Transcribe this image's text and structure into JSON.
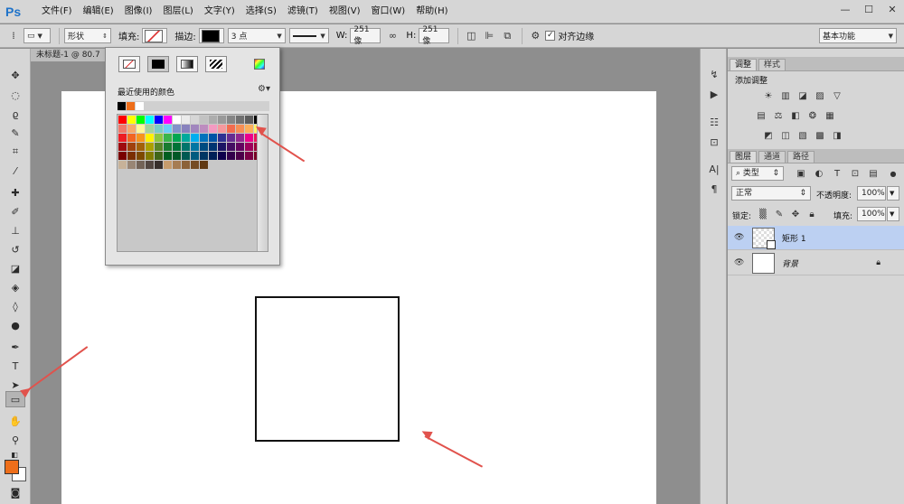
{
  "app": {
    "logo": "Ps",
    "menu": [
      "文件(F)",
      "编辑(E)",
      "图像(I)",
      "图层(L)",
      "文字(Y)",
      "选择(S)",
      "滤镜(T)",
      "视图(V)",
      "窗口(W)",
      "帮助(H)"
    ],
    "window_controls": [
      "—",
      "☐",
      "✕"
    ]
  },
  "options": {
    "shape_mode": "形状",
    "fill_label": "填充:",
    "stroke_label": "描边:",
    "stroke_size": "3 点",
    "w_label": "W:",
    "w_value": "251 像",
    "h_label": "H:",
    "h_value": "251 像",
    "align_edges": "对齐边缘",
    "workspace": "基本功能",
    "stroke_color": "#000000"
  },
  "document": {
    "tab_title": "未标题-1 @ 80.7"
  },
  "fill_popup": {
    "recent_label": "最近使用的颜色",
    "recent_colors": [
      "#000000",
      "#ee6e1a",
      "#ffffff"
    ],
    "swatches": [
      "#ff0000",
      "#ffff00",
      "#00ff00",
      "#00ffff",
      "#0000ff",
      "#ff00ff",
      "#ffffff",
      "#ebebeb",
      "#d6d6d6",
      "#c2c2c2",
      "#adadad",
      "#999999",
      "#858585",
      "#707070",
      "#5c5c5c",
      "#000000",
      "#f0786a",
      "#f7a96b",
      "#fff799",
      "#a3d39c",
      "#7accc8",
      "#6dcff6",
      "#8393ca",
      "#8882be",
      "#a186be",
      "#bd8cbf",
      "#f49ac1",
      "#f5989d",
      "#f26c4f",
      "#f68e55",
      "#fbaf5c",
      "#fff467",
      "#ed1c24",
      "#f26522",
      "#f7941d",
      "#fff200",
      "#8dc63f",
      "#39b54a",
      "#00a651",
      "#00a99d",
      "#00aeef",
      "#0072bc",
      "#0054a6",
      "#2e3192",
      "#662d91",
      "#92278f",
      "#ec008c",
      "#ed145b",
      "#9e0b0f",
      "#a0410d",
      "#a3620a",
      "#aba000",
      "#598527",
      "#197b30",
      "#007236",
      "#00746b",
      "#0076a3",
      "#004b80",
      "#003471",
      "#1b1464",
      "#440e62",
      "#630460",
      "#9e005d",
      "#9e0039",
      "#790000",
      "#7b2e00",
      "#7d4900",
      "#827b00",
      "#406618",
      "#005e20",
      "#005826",
      "#005952",
      "#005b7f",
      "#003663",
      "#002157",
      "#0d004c",
      "#32004b",
      "#4b0049",
      "#7b0046",
      "#7a0026",
      "#c7b299",
      "#998675",
      "#736357",
      "#534741",
      "#372f2c",
      "#c69c6d",
      "#a67c52",
      "#8c6239",
      "#754c24",
      "#603913"
    ]
  },
  "panels": {
    "top_tabs": [
      "调整",
      "样式"
    ],
    "adjust_title": "添加调整",
    "adjust_icons_row1": [
      "☀",
      "▥",
      "◪",
      "▨",
      "▽"
    ],
    "adjust_icons_row2": [
      "▤",
      "⚖",
      "◧",
      "❂",
      "▦"
    ],
    "adjust_icons_row3": [
      "◩",
      "◫",
      "▧",
      "▩",
      "◨"
    ],
    "layer_tabs": [
      "图层",
      "通道",
      "路径"
    ],
    "filter_kind": "类型",
    "blend_mode": "正常",
    "opacity_label": "不透明度:",
    "opacity_value": "100%",
    "lock_label": "锁定:",
    "fill_label": "填充:",
    "fill_value": "100%",
    "layers": [
      {
        "name": "矩形 1",
        "selected": true
      },
      {
        "name": "背景",
        "selected": false
      }
    ]
  },
  "colors": {
    "foreground": "#ee6e1a",
    "background": "#ffffff",
    "selected_layer": "#bcd0f2",
    "arrow": "#e1524c"
  }
}
